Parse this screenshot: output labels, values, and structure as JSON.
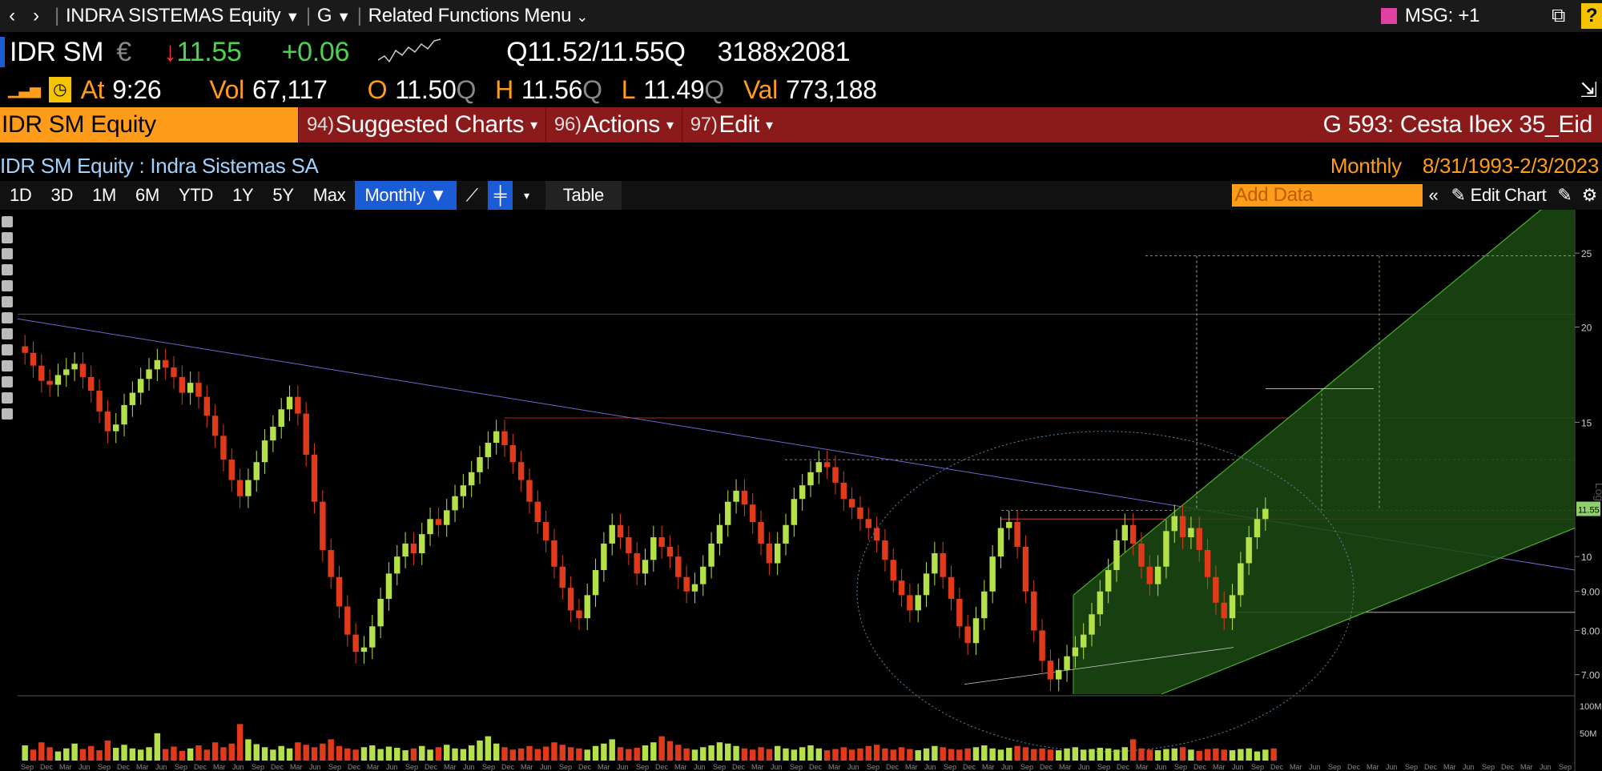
{
  "nav": {
    "back": "‹",
    "forward": "›",
    "security": "INDRA SISTEMAS Equity",
    "function": "G",
    "related": "Related Functions Menu",
    "msg": "MSG: +1",
    "help": "?"
  },
  "quote": {
    "ticker": "IDR SM",
    "currency": "€",
    "last": "11.55",
    "change": "+0.06",
    "bid_ask": "Q11.52/11.55Q",
    "size": "3188x2081",
    "at_label": "At",
    "time": "9:26",
    "vol_label": "Vol",
    "vol": "67,117",
    "open_label": "O",
    "open": "11.50",
    "high_label": "H",
    "high": "11.56",
    "low_label": "L",
    "low": "11.49",
    "val_label": "Val",
    "val": "773,188",
    "q": "Q"
  },
  "header": {
    "ticker_box": "IDR SM Equity",
    "menu": [
      {
        "num": "94)",
        "label": "Suggested Charts"
      },
      {
        "num": "96)",
        "label": "Actions"
      },
      {
        "num": "97)",
        "label": "Edit"
      }
    ],
    "basket": "G 593: Cesta Ibex 35_Eid"
  },
  "info": {
    "title": "IDR SM Equity : Indra Sistemas SA",
    "period": "Monthly",
    "range": "8/31/1993-2/3/2023"
  },
  "toolbar": {
    "ranges": [
      "1D",
      "3D",
      "1M",
      "6M",
      "YTD",
      "1Y",
      "5Y",
      "Max"
    ],
    "frequency": "Monthly ▼",
    "table": "Table",
    "add_data_placeholder": "Add Data",
    "edit_chart": "Edit Chart"
  },
  "chart_data": {
    "type": "candlestick",
    "scale": "Log",
    "y_ticks": [
      25,
      20,
      15,
      10,
      9.0,
      8.0,
      7.0
    ],
    "y_tick_labels": [
      "25",
      "20",
      "15",
      "10",
      "9.00",
      "8.00",
      "7.00"
    ],
    "last_price_label": "11.55",
    "volume_ticks": [
      "100M",
      "50M"
    ],
    "closes": [
      18.5,
      17.8,
      17.0,
      16.8,
      17.3,
      17.6,
      17.9,
      17.2,
      16.5,
      15.5,
      14.6,
      14.9,
      15.8,
      16.4,
      17.1,
      17.6,
      18.1,
      17.7,
      17.2,
      16.4,
      16.9,
      16.2,
      15.3,
      14.4,
      13.4,
      12.6,
      12.0,
      12.6,
      13.3,
      14.2,
      14.8,
      15.6,
      16.2,
      15.4,
      13.6,
      11.8,
      10.2,
      9.4,
      8.6,
      7.9,
      7.5,
      7.6,
      8.1,
      8.8,
      9.5,
      10.0,
      10.4,
      10.1,
      10.7,
      11.2,
      11.0,
      11.5,
      12.0,
      12.4,
      12.9,
      13.5,
      14.1,
      14.6,
      14.0,
      13.3,
      12.6,
      11.8,
      11.1,
      10.5,
      9.7,
      9.1,
      8.5,
      8.3,
      8.9,
      9.6,
      10.4,
      11.0,
      10.6,
      10.1,
      9.5,
      9.9,
      10.6,
      10.3,
      10.0,
      9.4,
      9.0,
      9.2,
      9.7,
      10.4,
      11.0,
      11.8,
      12.2,
      11.7,
      11.1,
      10.4,
      9.8,
      10.4,
      11.0,
      11.9,
      12.4,
      12.9,
      13.3,
      13.1,
      12.5,
      11.9,
      11.6,
      11.2,
      10.9,
      10.5,
      9.9,
      9.3,
      8.9,
      8.5,
      8.9,
      9.5,
      10.1,
      9.4,
      8.8,
      8.1,
      7.7,
      8.3,
      9.0,
      10.0,
      10.9,
      11.1,
      10.3,
      9.0,
      8.0,
      7.3,
      6.9,
      7.1,
      7.4,
      7.6,
      7.9,
      8.4,
      9.0,
      9.6,
      10.5,
      11.0,
      10.4,
      9.7,
      9.2,
      9.7,
      10.8,
      11.3,
      10.6,
      10.9,
      10.2,
      9.4,
      8.7,
      8.3,
      8.9,
      9.8,
      10.6,
      11.2,
      11.55
    ],
    "volumes": [
      25,
      18,
      30,
      22,
      15,
      20,
      28,
      19,
      24,
      17,
      33,
      21,
      26,
      20,
      18,
      22,
      45,
      19,
      23,
      16,
      20,
      25,
      18,
      30,
      22,
      28,
      60,
      35,
      27,
      22,
      18,
      24,
      20,
      30,
      26,
      22,
      28,
      35,
      24,
      20,
      18,
      22,
      25,
      19,
      23,
      21,
      17,
      20,
      24,
      18,
      22,
      26,
      20,
      19,
      25,
      33,
      40,
      28,
      22,
      18,
      20,
      24,
      19,
      23,
      30,
      26,
      22,
      20,
      18,
      24,
      28,
      35,
      22,
      19,
      21,
      25,
      30,
      40,
      32,
      26,
      20,
      18,
      22,
      25,
      30,
      28,
      24,
      20,
      18,
      22,
      19,
      24,
      20,
      18,
      22,
      25,
      20,
      17,
      19,
      22,
      18,
      20,
      24,
      26,
      20,
      18,
      22,
      19,
      17,
      20,
      24,
      22,
      19,
      18,
      20,
      22,
      25,
      20,
      18,
      21,
      24,
      22,
      19,
      20,
      18,
      17,
      20,
      22,
      18,
      19,
      21,
      20,
      18,
      22,
      35,
      20,
      18,
      17,
      19,
      20,
      22,
      18,
      16,
      19,
      20,
      18,
      17,
      19,
      20,
      15,
      18,
      20
    ],
    "x_tick_labels": [
      "Sep",
      "Dec",
      "Mar",
      "Jun"
    ]
  },
  "colors": {
    "up": "#b4e04a",
    "down": "#e03a1a",
    "accent_orange": "#ff9c1a",
    "header_red": "#8b1a1a",
    "active_blue": "#1a5cd6"
  }
}
